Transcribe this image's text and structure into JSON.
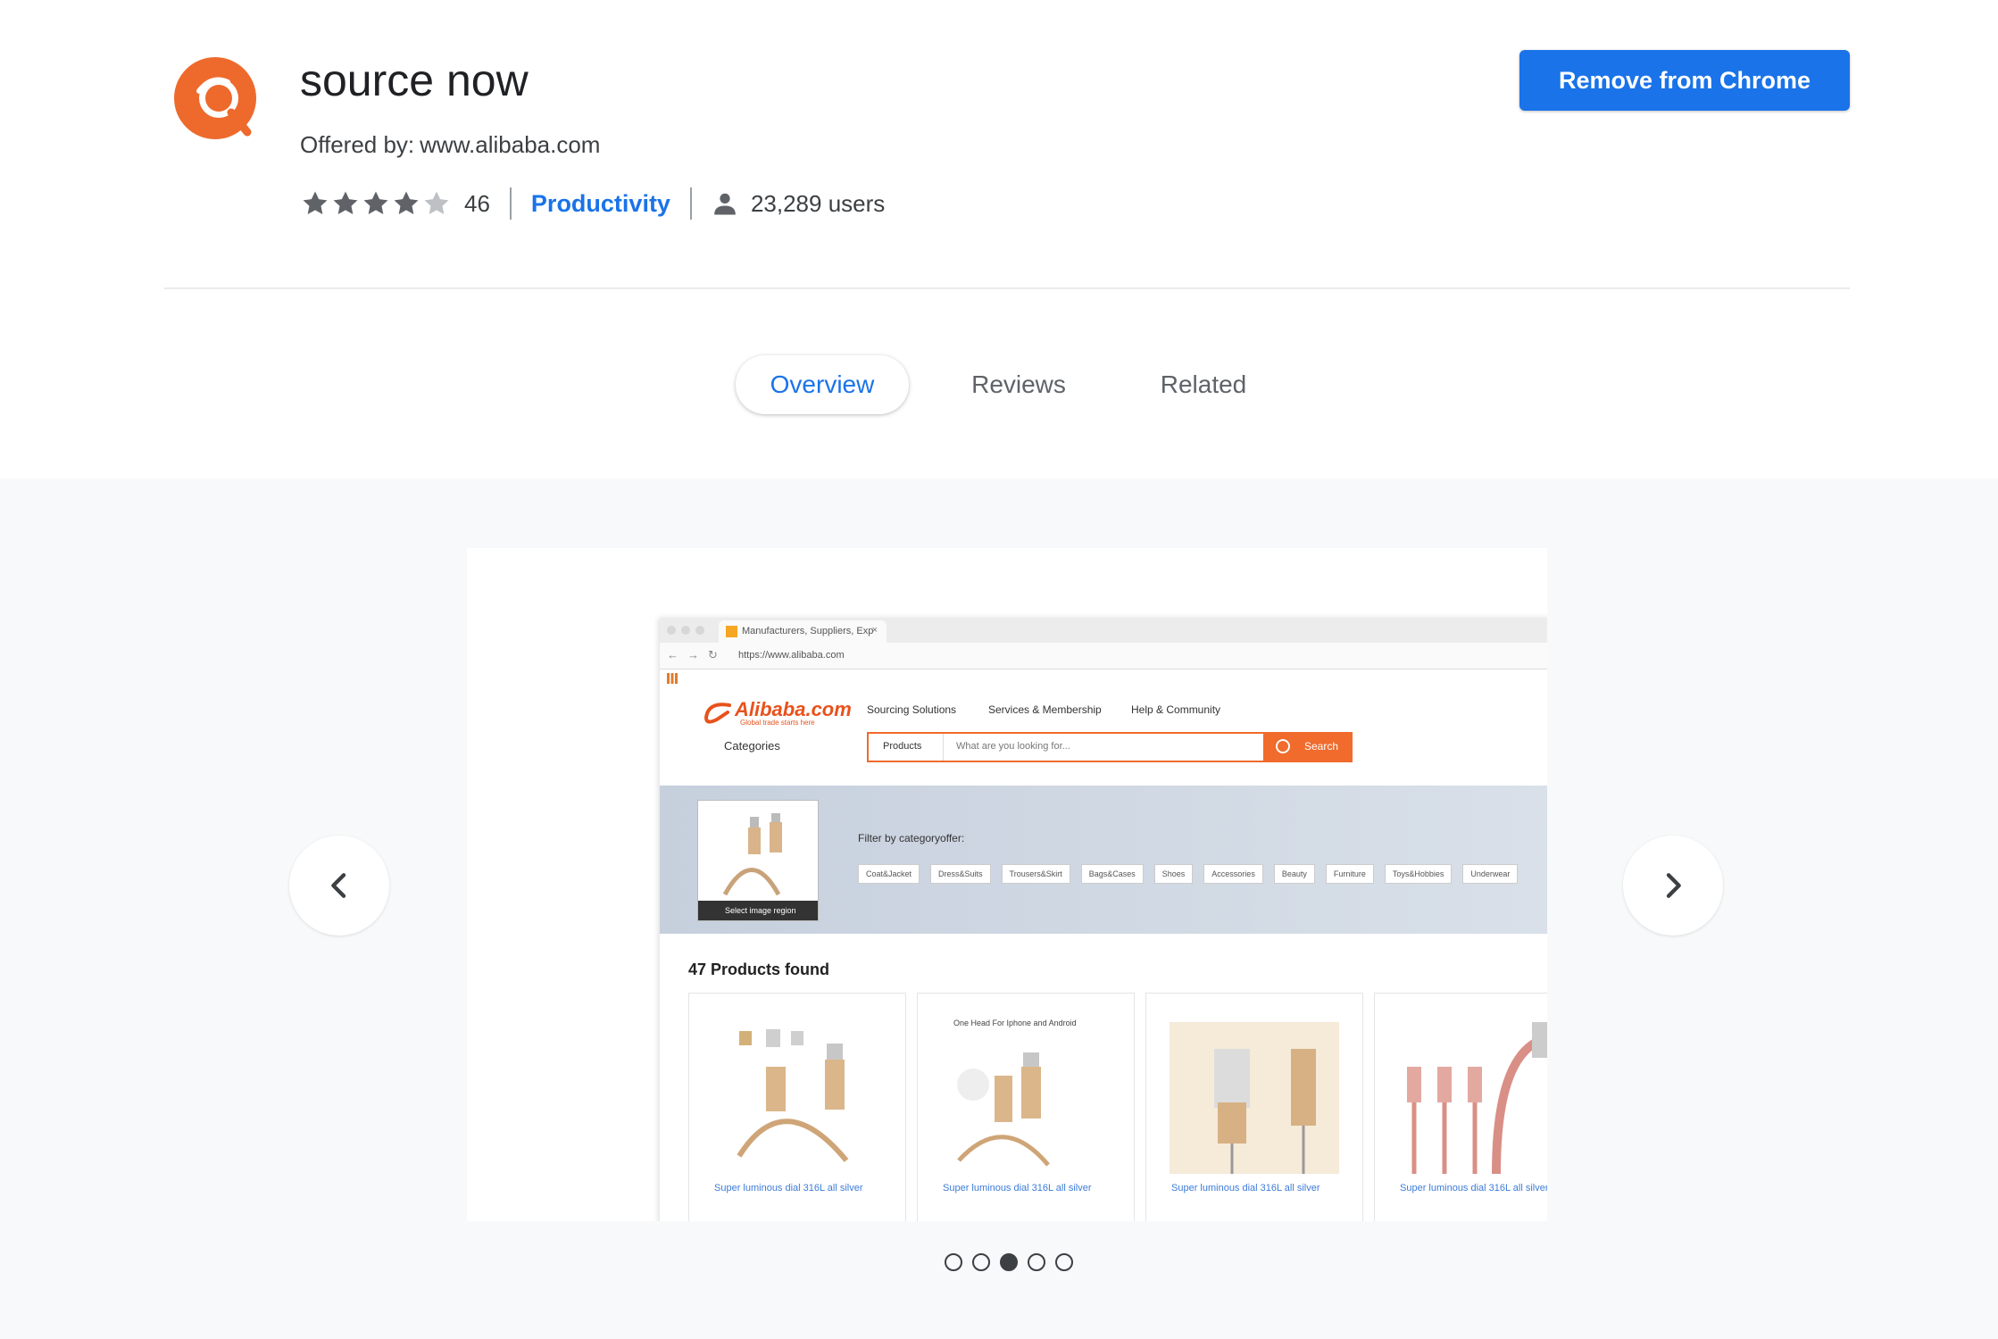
{
  "extension": {
    "name": "source now",
    "offered_by_label": "Offered by:",
    "offered_by_value": "www.alibaba.com",
    "rating_stars": 4,
    "rating_max": 5,
    "rating_count": "46",
    "category": "Productivity",
    "users": "23,289 users",
    "brand_color": "#ee6a2c"
  },
  "actions": {
    "remove_label": "Remove from Chrome",
    "accent_color": "#1a73e8"
  },
  "tabs": [
    {
      "label": "Overview",
      "active": true
    },
    {
      "label": "Reviews",
      "active": false
    },
    {
      "label": "Related",
      "active": false
    }
  ],
  "gallery": {
    "prev_icon": "chevron-left-icon",
    "next_icon": "chevron-right-icon",
    "dots_total": 5,
    "active_dot_index": 2
  },
  "screenshot_mock": {
    "tab_title": "Manufacturers, Suppliers, Exp",
    "url": "https://www.alibaba.com",
    "logo_text": "Alibaba.com",
    "logo_tagline": "Global trade starts here",
    "menu": [
      "Sourcing Solutions",
      "Services & Membership",
      "Help & Community"
    ],
    "categories_label": "Categories",
    "search_select": "Products",
    "search_placeholder": "What are you looking for...",
    "search_button": "Search",
    "select_region": "Select image region",
    "filter_label": "Filter by categoryoffer:",
    "chips": [
      "Coat&Jacket",
      "Dress&Suits",
      "Trousers&Skirt",
      "Bags&Cases",
      "Shoes",
      "Accessories",
      "Beauty",
      "Furniture",
      "Toys&Hobbies",
      "Underwear"
    ],
    "products_found": "47 Products found",
    "card_top_text": "One Head For Iphone and Android",
    "card_caption": "Super luminous dial 316L all silver"
  }
}
